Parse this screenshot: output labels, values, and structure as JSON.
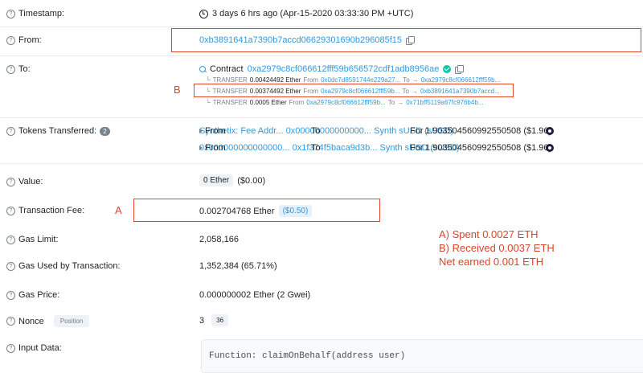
{
  "rows": {
    "timestamp": {
      "label": "Timestamp:",
      "value": "3 days 6 hrs ago (Apr-15-2020 03:33:30 PM +UTC)"
    },
    "from": {
      "label": "From:",
      "address": "0xb3891641a7390b7accd06629301690b296085f15"
    },
    "to": {
      "label": "To:",
      "contract_prefix": "Contract",
      "contract_address": "0xa2979c8cf066612fff59b656572cdf1adb8956ae",
      "transfers": [
        {
          "type": "TRANSFER",
          "amount": "0.00424492 Ether",
          "from_label": "From",
          "from": "0x0dc7d8591744e229a27...",
          "to_label": "To",
          "to": "0xa2979c8cf066612fff59b..."
        },
        {
          "type": "TRANSFER",
          "amount": "0.00374492 Ether",
          "from_label": "From",
          "from": "0xa2979c8cf066612fff59b...",
          "to_label": "To",
          "to": "0xb3891641a7390b7accd..."
        },
        {
          "type": "TRANSFER",
          "amount": "0.0005 Ether",
          "from_label": "From",
          "from": "0xa2979c8cf066612fff59b...",
          "to_label": "To",
          "to": "0x71bff5119a67fc976b4b..."
        }
      ]
    },
    "tokens": {
      "label": "Tokens Transferred:",
      "count": "2",
      "items": [
        {
          "from_label": "From",
          "from": "Synthetix: Fee Addr...",
          "to_label": "To",
          "to": "0x00000000000000...",
          "for_label": "For",
          "amount": "1.903504560992550508 ($1.96)",
          "token": "Synth sUSD (sUSD)"
        },
        {
          "from_label": "From",
          "from": "0x000000000000000...",
          "to_label": "To",
          "to": "0x1f374f5baca9d3b...",
          "for_label": "For",
          "amount": "1.903504560992550508 ($1.96)",
          "token": "Synth sUSD (sUSD)"
        }
      ]
    },
    "value": {
      "label": "Value:",
      "badge": "0 Ether",
      "usd": "($0.00)"
    },
    "fee": {
      "label": "Transaction Fee:",
      "value": "0.002704768 Ether",
      "usd": "($0.50)"
    },
    "gas_limit": {
      "label": "Gas Limit:",
      "value": "2,058,166"
    },
    "gas_used": {
      "label": "Gas Used by Transaction:",
      "value": "1,352,384 (65.71%)"
    },
    "gas_price": {
      "label": "Gas Price:",
      "value": "0.000000002 Ether (2 Gwei)"
    },
    "nonce": {
      "label": "Nonce",
      "position_badge": "Position",
      "value": "3",
      "position": "36"
    },
    "input": {
      "label": "Input Data:",
      "code": "Function: claimOnBehalf(address user)"
    }
  },
  "annotations": {
    "marker_a": "A",
    "marker_b": "B",
    "lines": [
      "A) Spent 0.0027 ETH",
      "B) Received 0.0037 ETH",
      "Net earned 0.001 ETH"
    ],
    "color": "#d9452b"
  },
  "colors": {
    "link": "#3498db",
    "muted": "#77838f",
    "accent_green": "#00c9a7"
  },
  "icons": [
    "question-icon",
    "clock-icon",
    "copy-icon",
    "search-icon",
    "check-icon",
    "synth-token-icon"
  ]
}
